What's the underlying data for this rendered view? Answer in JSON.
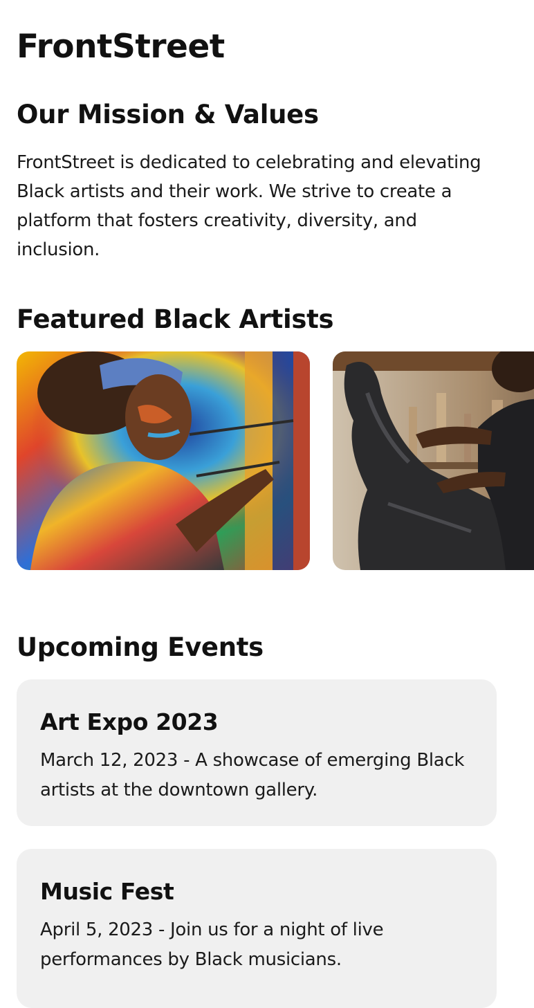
{
  "app": {
    "title": "FrontStreet"
  },
  "mission": {
    "heading": "Our Mission & Values",
    "text": "FrontStreet is dedicated to celebrating and elevating Black artists and their work. We strive to create a platform that fosters creativity, diversity, and inclusion."
  },
  "artists": {
    "heading": "Featured Black Artists",
    "cards": [
      {
        "image": "artist-painting-mural-photo"
      },
      {
        "image": "artist-sculpting-photo"
      }
    ]
  },
  "events": {
    "heading": "Upcoming Events",
    "items": [
      {
        "title": "Art Expo 2023",
        "description": "March 12, 2023 - A showcase of emerging Black artists at the downtown gallery."
      },
      {
        "title": "Music Fest",
        "description": "April 5, 2023 - Join us for a night of live performances by Black musicians."
      }
    ]
  },
  "colors": {
    "background": "#ffffff",
    "text": "#111111",
    "card_background": "#f0f0f0"
  }
}
